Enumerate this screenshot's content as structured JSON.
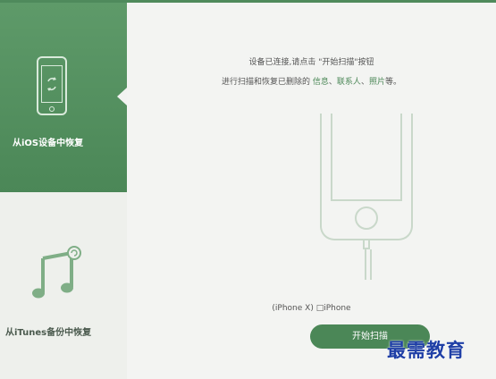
{
  "sidebar": {
    "items": [
      {
        "label": "从iOS设备中恢复",
        "icon": "iphone-refresh-icon",
        "active": true
      },
      {
        "label": "从iTunes备份中恢复",
        "icon": "music-note-icon",
        "active": false
      }
    ]
  },
  "main": {
    "instruction_line1": "设备已连接,请点击 \"开始扫描\"按钮",
    "instruction_prefix": "进行扫描和恢复已删除的",
    "link_info": "信息",
    "sep1": "、",
    "link_contacts": "联系人",
    "sep2": "、",
    "link_photos": "照片",
    "instruction_suffix": "等。",
    "device_name": "(iPhone X) □iPhone",
    "start_button": "开始扫描"
  },
  "watermark": "最需教育",
  "colors": {
    "accent": "#4b8757",
    "sidebar_bg": "#eef0ec",
    "main_bg": "#f3f4f2"
  }
}
